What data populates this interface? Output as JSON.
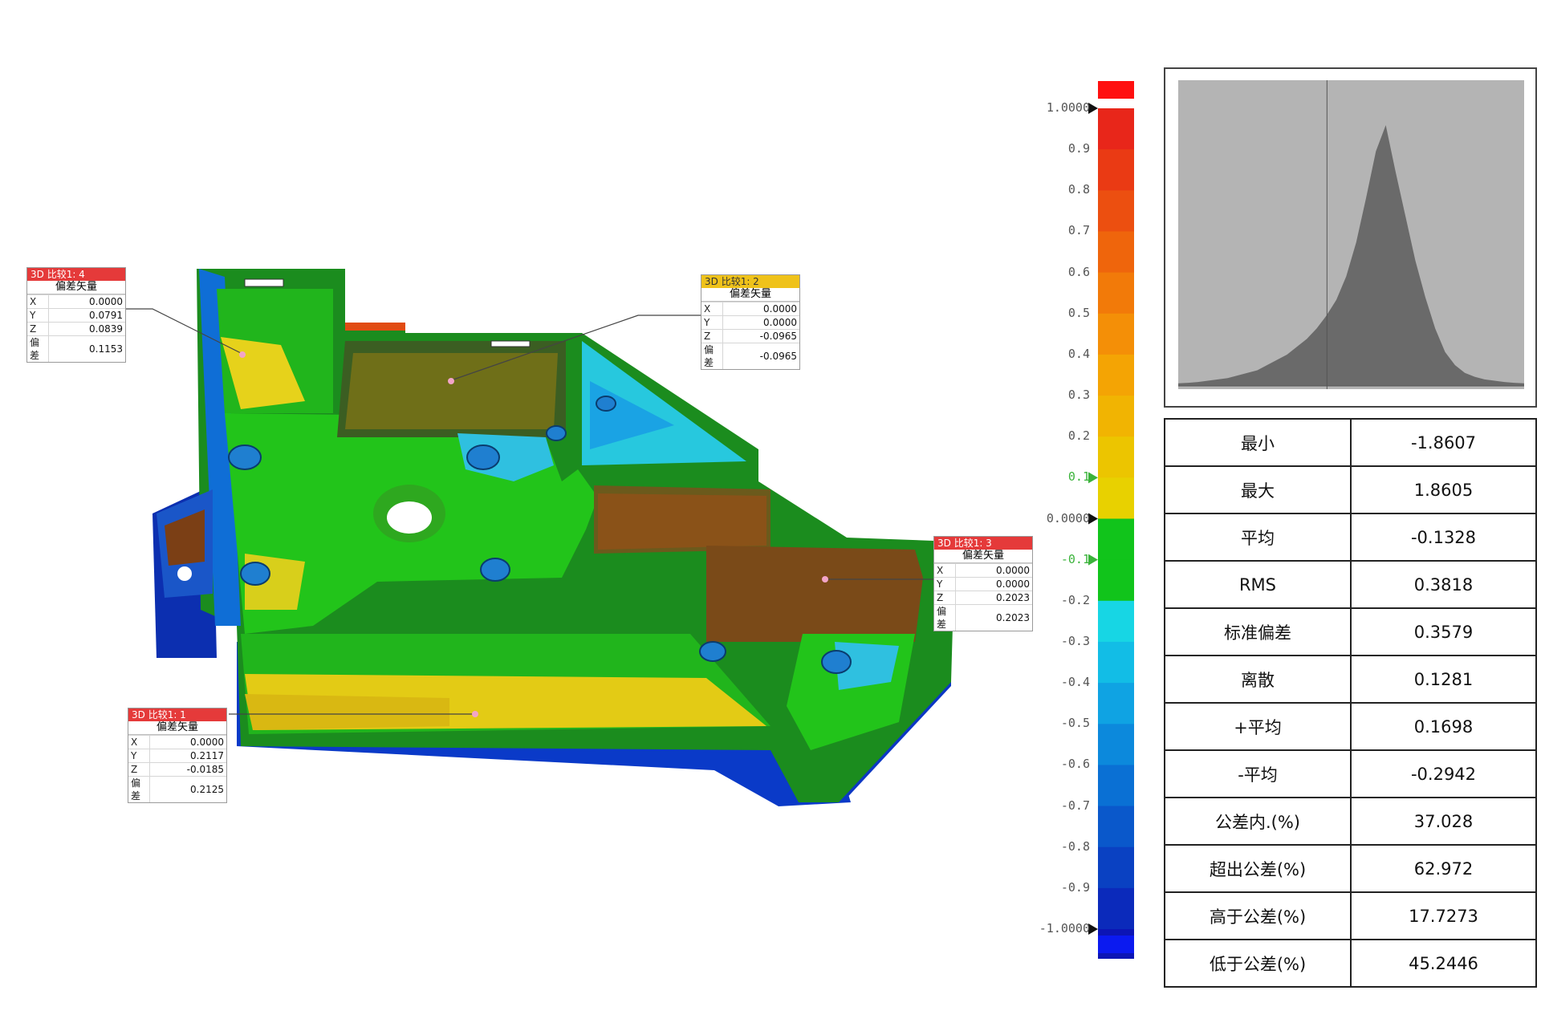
{
  "callouts": [
    {
      "id": "c4",
      "header": "3D 比较1: 4",
      "header_color": "#e53a3a",
      "subtitle": "偏差矢量",
      "rows": [
        {
          "k": "X",
          "v": "0.0000"
        },
        {
          "k": "Y",
          "v": "0.0791"
        },
        {
          "k": "Z",
          "v": "0.0839"
        },
        {
          "k": "偏差",
          "v": "0.1153"
        }
      ]
    },
    {
      "id": "c2",
      "header": "3D 比较1: 2",
      "header_color": "#efc21a",
      "subtitle": "偏差矢量",
      "rows": [
        {
          "k": "X",
          "v": "0.0000"
        },
        {
          "k": "Y",
          "v": "0.0000"
        },
        {
          "k": "Z",
          "v": "-0.0965"
        },
        {
          "k": "偏差",
          "v": "-0.0965"
        }
      ]
    },
    {
      "id": "c3",
      "header": "3D 比较1: 3",
      "header_color": "#e53a3a",
      "subtitle": "偏差矢量",
      "rows": [
        {
          "k": "X",
          "v": "0.0000"
        },
        {
          "k": "Y",
          "v": "0.0000"
        },
        {
          "k": "Z",
          "v": "0.2023"
        },
        {
          "k": "偏差",
          "v": "0.2023"
        }
      ]
    },
    {
      "id": "c1",
      "header": "3D 比较1: 1",
      "header_color": "#e53a3a",
      "subtitle": "偏差矢量",
      "rows": [
        {
          "k": "X",
          "v": "0.0000"
        },
        {
          "k": "Y",
          "v": "0.2117"
        },
        {
          "k": "Z",
          "v": "-0.0185"
        },
        {
          "k": "偏差",
          "v": "0.2125"
        }
      ]
    }
  ],
  "scale": {
    "labels": [
      "1.0000",
      "0.9",
      "0.8",
      "0.7",
      "0.6",
      "0.5",
      "0.4",
      "0.3",
      "0.2",
      "0.1",
      "0.0000",
      "-0.1",
      "-0.2",
      "-0.3",
      "-0.4",
      "-0.5",
      "-0.6",
      "-0.7",
      "-0.8",
      "-0.9",
      "-1.0000"
    ],
    "values": [
      1.0,
      0.9,
      0.8,
      0.7,
      0.6,
      0.5,
      0.4,
      0.3,
      0.2,
      0.1,
      0.0,
      -0.1,
      -0.2,
      -0.3,
      -0.4,
      -0.5,
      -0.6,
      -0.7,
      -0.8,
      -0.9,
      -1.0
    ],
    "green_labels": [
      "0.1",
      "-0.1"
    ],
    "colors_top_to_bottom": [
      "#e8261a",
      "#ea3a14",
      "#ec4f10",
      "#ef650c",
      "#f27a09",
      "#f48f07",
      "#f4a404",
      "#f1b402",
      "#ecc500",
      "#e8d100",
      "#11c41b",
      "#11c41b",
      "#17d6e4",
      "#12bde6",
      "#0fa3e3",
      "#0c89dc",
      "#0a70d4",
      "#0a58cb",
      "#0a41c2",
      "#0b2abb",
      "#0c15b5"
    ],
    "over_color": "#ff1010",
    "under_color": "#0b1af0"
  },
  "histogram": {
    "bins": [
      0.01,
      0.012,
      0.015,
      0.02,
      0.025,
      0.03,
      0.04,
      0.05,
      0.06,
      0.08,
      0.1,
      0.12,
      0.15,
      0.18,
      0.22,
      0.27,
      0.33,
      0.42,
      0.55,
      0.72,
      0.9,
      1.0,
      0.82,
      0.65,
      0.48,
      0.34,
      0.22,
      0.13,
      0.08,
      0.05,
      0.035,
      0.025,
      0.02,
      0.015,
      0.012,
      0.01
    ],
    "bg": "#b4b4b4",
    "fill": "#6a6a6a"
  },
  "stats": [
    {
      "label": "最小",
      "value": "-1.8607"
    },
    {
      "label": "最大",
      "value": "1.8605"
    },
    {
      "label": "平均",
      "value": "-0.1328"
    },
    {
      "label": "RMS",
      "value": "0.3818"
    },
    {
      "label": "标准偏差",
      "value": "0.3579"
    },
    {
      "label": "离散",
      "value": "0.1281"
    },
    {
      "label": "+平均",
      "value": "0.1698"
    },
    {
      "label": "-平均",
      "value": "-0.2942"
    },
    {
      "label": "公差内.(%)",
      "value": "37.028"
    },
    {
      "label": "超出公差(%)",
      "value": "62.972"
    },
    {
      "label": "高于公差(%)",
      "value": "17.7273"
    },
    {
      "label": "低于公差(%)",
      "value": "45.2446"
    }
  ]
}
